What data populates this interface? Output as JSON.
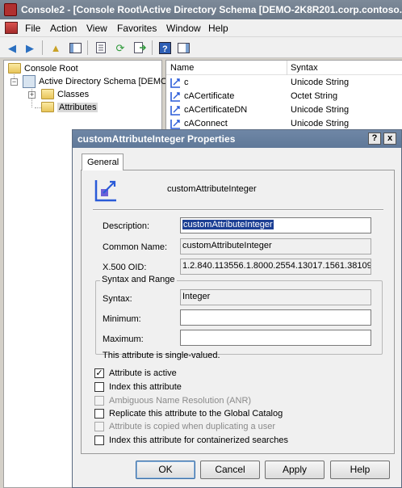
{
  "window": {
    "title": "Console2 - [Console Root\\Active Directory Schema [DEMO-2K8R201.corp.contoso.co"
  },
  "menu": {
    "items": [
      "File",
      "Action",
      "View",
      "Favorites",
      "Window",
      "Help"
    ]
  },
  "toolbar": {
    "icons": [
      "back-arrow-icon",
      "forward-arrow-icon",
      "up-folder-icon",
      "show-hide-tree-icon",
      "properties-icon",
      "refresh-icon",
      "export-list-icon",
      "help-icon",
      "show-hide-action-pane-icon"
    ]
  },
  "tree": {
    "root": "Console Root",
    "schema": "Active Directory Schema [DEMO",
    "classes": "Classes",
    "attributes": "Attributes"
  },
  "list": {
    "columns": {
      "name": "Name",
      "syntax": "Syntax"
    },
    "rows": [
      {
        "name": "c",
        "syntax": "Unicode String"
      },
      {
        "name": "cACertificate",
        "syntax": "Octet String"
      },
      {
        "name": "cACertificateDN",
        "syntax": "Unicode String"
      },
      {
        "name": "cAConnect",
        "syntax": "Unicode String"
      }
    ]
  },
  "dialog": {
    "title": "customAttributeInteger Properties",
    "help_button": "?",
    "close_button": "x",
    "tab_general": "General",
    "object_name": "customAttributeInteger",
    "description_label": "Description:",
    "description_value": "customAttributeInteger",
    "common_name_label": "Common Name:",
    "common_name_value": "customAttributeInteger",
    "oid_label": "X.500 OID:",
    "oid_value": "1.2.840.113556.1.8000.2554.13017.1561.38109.",
    "syntax_group_title": "Syntax and Range",
    "syntax_label": "Syntax:",
    "syntax_value": "Integer",
    "minimum_label": "Minimum:",
    "minimum_value": "",
    "maximum_label": "Maximum:",
    "maximum_value": "",
    "single_valued_note": "This attribute is single-valued.",
    "checkboxes": [
      {
        "label": "Attribute is active",
        "checked": true,
        "enabled": true
      },
      {
        "label": "Index this attribute",
        "checked": false,
        "enabled": true
      },
      {
        "label": "Ambiguous Name Resolution (ANR)",
        "checked": false,
        "enabled": false
      },
      {
        "label": "Replicate this attribute to the Global Catalog",
        "checked": false,
        "enabled": true
      },
      {
        "label": "Attribute is copied when duplicating a user",
        "checked": false,
        "enabled": false
      },
      {
        "label": "Index this attribute for containerized searches",
        "checked": false,
        "enabled": true
      }
    ],
    "buttons": {
      "ok": "OK",
      "cancel": "Cancel",
      "apply": "Apply",
      "help": "Help"
    }
  },
  "colors": {
    "selection": "#1c3f94",
    "titlebar": "#6b7888",
    "dialog_titlebar": "#5f7898"
  }
}
